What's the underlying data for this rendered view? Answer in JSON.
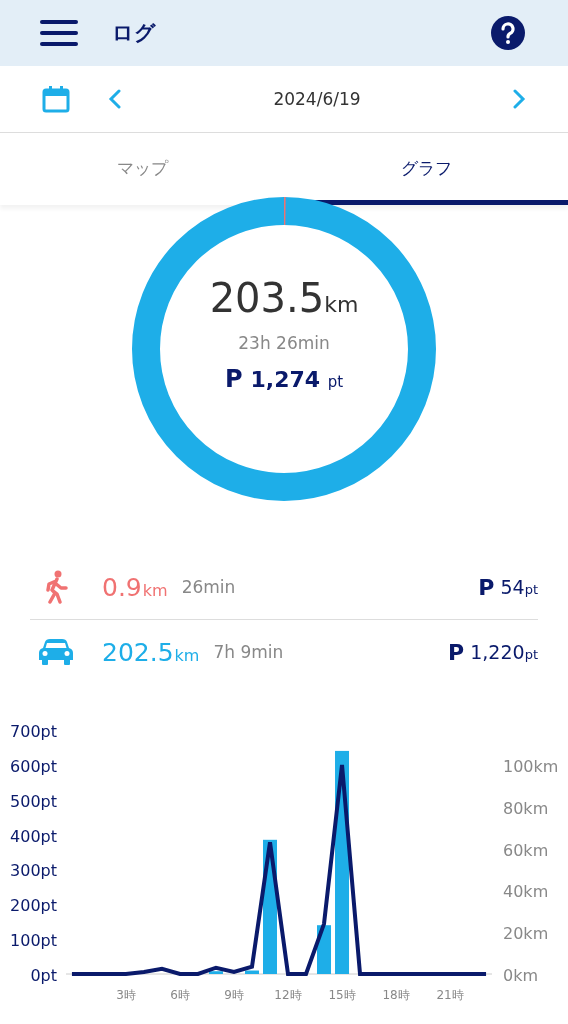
{
  "header": {
    "title": "ログ"
  },
  "date_nav": {
    "date": "2024/6/19"
  },
  "tabs": [
    {
      "label": "マップ",
      "selected": false
    },
    {
      "label": "グラフ",
      "selected": true
    }
  ],
  "summary": {
    "distance": "203.5",
    "distance_unit": "km",
    "duration": "23h 26min",
    "points_mark": "P",
    "points": "1,274",
    "points_unit": "pt"
  },
  "modes": [
    {
      "kind": "walk",
      "color": "#f07272",
      "distance": "0.9",
      "distance_unit": "km",
      "duration": "26min",
      "points_mark": "P",
      "points": "54",
      "points_unit": "pt"
    },
    {
      "kind": "car",
      "color": "#1eaee8",
      "distance": "202.5",
      "distance_unit": "km",
      "duration": "7h 9min",
      "points_mark": "P",
      "points": "1,220",
      "points_unit": "pt"
    }
  ],
  "chart": {
    "chart_data": {
      "type": "bar",
      "xlim": [
        -0.33,
        23.33
      ],
      "x": [
        0,
        1,
        2,
        3,
        4,
        5,
        6,
        7,
        8,
        9,
        10,
        11,
        12,
        13,
        14,
        15,
        16,
        17,
        18,
        19,
        20,
        21,
        22,
        23
      ],
      "xticks": [
        {
          "value": 3,
          "label": "3時"
        },
        {
          "value": 6,
          "label": "6時"
        },
        {
          "value": 9,
          "label": "9時"
        },
        {
          "value": 12,
          "label": "12時"
        },
        {
          "value": 15,
          "label": "15時"
        },
        {
          "value": 18,
          "label": "18時"
        },
        {
          "value": 21,
          "label": "21時"
        }
      ],
      "ylim": [
        0,
        700
      ],
      "yticks": [
        {
          "value": 0,
          "label": "0pt"
        },
        {
          "value": 100,
          "label": "100pt"
        },
        {
          "value": 200,
          "label": "200pt"
        },
        {
          "value": 300,
          "label": "300pt"
        },
        {
          "value": 400,
          "label": "400pt"
        },
        {
          "value": 500,
          "label": "500pt"
        },
        {
          "value": 600,
          "label": "600pt"
        },
        {
          "value": 700,
          "label": "700pt"
        }
      ],
      "y2lim": [
        0,
        100
      ],
      "y2ticks": [
        {
          "value": 0,
          "label": "0km"
        },
        {
          "value": 20,
          "label": "20km"
        },
        {
          "value": 40,
          "label": "40km"
        },
        {
          "value": 60,
          "label": "60km"
        },
        {
          "value": 80,
          "label": "80km"
        },
        {
          "value": 100,
          "label": "100km"
        }
      ],
      "series": [
        {
          "type": "bar",
          "color": "#1eaee8",
          "values": [
            0,
            0,
            0,
            0,
            0,
            0,
            0,
            0,
            8,
            0,
            10,
            385,
            0,
            0,
            140,
            640,
            0,
            0,
            0,
            0,
            0,
            0,
            0,
            0
          ]
        },
        {
          "type": "line",
          "axis": "y2",
          "color": "#0a1a6b",
          "values": [
            0,
            0,
            0,
            0,
            1,
            2.5,
            0,
            0,
            3,
            1,
            3.5,
            63,
            0,
            0,
            24,
            100,
            0,
            0,
            0,
            0,
            0,
            0,
            0,
            0
          ]
        }
      ]
    }
  }
}
